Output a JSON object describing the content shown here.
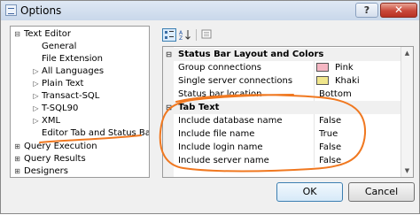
{
  "window": {
    "title": "Options",
    "help_label": "?",
    "close_label": "✕",
    "icon": "options-window-icon"
  },
  "tree": {
    "items": [
      {
        "label": "Text Editor",
        "glyph": "⊟",
        "level": 0
      },
      {
        "label": "General",
        "glyph": "",
        "level": 1
      },
      {
        "label": "File Extension",
        "glyph": "",
        "level": 1
      },
      {
        "label": "All Languages",
        "glyph": "▷",
        "level": 1
      },
      {
        "label": "Plain Text",
        "glyph": "▷",
        "level": 1
      },
      {
        "label": "Transact-SQL",
        "glyph": "▷",
        "level": 1
      },
      {
        "label": "T-SQL90",
        "glyph": "▷",
        "level": 1
      },
      {
        "label": "XML",
        "glyph": "▷",
        "level": 1
      },
      {
        "label": "Editor Tab and Status Bar",
        "glyph": "",
        "level": 1
      },
      {
        "label": "Query Execution",
        "glyph": "⊞",
        "level": 0
      },
      {
        "label": "Query Results",
        "glyph": "⊞",
        "level": 0
      },
      {
        "label": "Designers",
        "glyph": "⊞",
        "level": 0
      }
    ]
  },
  "toolbar": {
    "categorized_icon": "categorized-icon",
    "alphabetical_icon": "alphabetical-sort-icon",
    "property_pages_icon": "property-pages-icon"
  },
  "grid": {
    "categories": [
      {
        "name": "Status Bar Layout and Colors",
        "toggle": "⊟",
        "rows": [
          {
            "name": "Group connections",
            "value": "Pink",
            "swatch": "#f4b6c2"
          },
          {
            "name": "Single server connections",
            "value": "Khaki",
            "swatch": "#f0e68c"
          },
          {
            "name": "Status bar location",
            "value": "Bottom",
            "swatch": ""
          }
        ]
      },
      {
        "name": "Tab Text",
        "toggle": "⊟",
        "rows": [
          {
            "name": "Include database name",
            "value": "False",
            "swatch": ""
          },
          {
            "name": "Include file name",
            "value": "True",
            "swatch": ""
          },
          {
            "name": "Include login name",
            "value": "False",
            "swatch": ""
          },
          {
            "name": "Include server name",
            "value": "False",
            "swatch": ""
          }
        ]
      }
    ]
  },
  "buttons": {
    "ok_label": "OK",
    "cancel_label": "Cancel"
  },
  "annotation": {
    "color": "#f07820"
  }
}
